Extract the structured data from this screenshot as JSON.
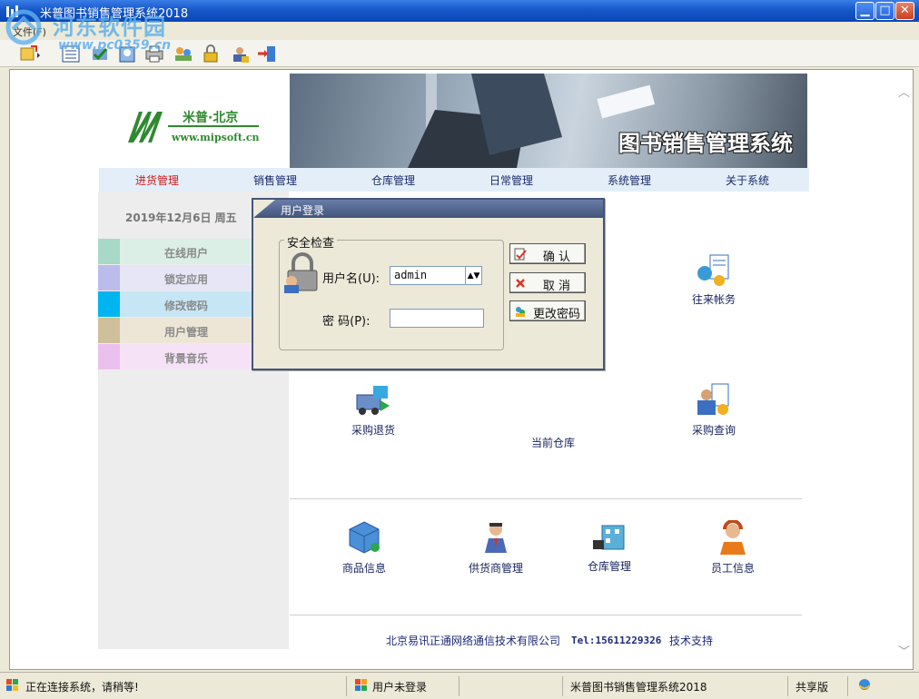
{
  "window": {
    "title": "米普图书销售管理系统2018",
    "minimize_label": "▁",
    "maximize_label": "□",
    "close_label": "✕"
  },
  "watermark": {
    "line1": "河东软件园",
    "line2": "www.pc0359.cn"
  },
  "menu": {
    "file_label": "文件(F)"
  },
  "toolbar": {
    "icons": [
      "new-icon",
      "list-icon",
      "check-icon",
      "user-icon",
      "print-icon",
      "people-icon",
      "lock-icon",
      "user-lock-icon",
      "exit-icon"
    ]
  },
  "logo": {
    "name": "米普·北京",
    "url": "www.mipsoft.cn"
  },
  "banner": {
    "title": "图书销售管理系统"
  },
  "nav": {
    "items": [
      "进货管理",
      "销售管理",
      "仓库管理",
      "日常管理",
      "系统管理",
      "关于系统"
    ]
  },
  "left_panel": {
    "date": "2019年12月6日  周五",
    "items": [
      {
        "label": "在线用户",
        "swatch": "#a8d8c8",
        "bg": "#dcefe6"
      },
      {
        "label": "锁定应用",
        "swatch": "#bcbcec",
        "bg": "#e6e6f6"
      },
      {
        "label": "修改密码",
        "swatch": "#00b4f0",
        "bg": "#c6e6f6"
      },
      {
        "label": "用户管理",
        "swatch": "#cfc09c",
        "bg": "#ede6d6"
      },
      {
        "label": "背景音乐",
        "swatch": "#ecc0ec",
        "bg": "#f6e2f6"
      }
    ]
  },
  "grid": {
    "row1": [
      {
        "label": "往来帐务",
        "icon": "accounts-icon"
      }
    ],
    "row2": [
      {
        "label": "采购退货",
        "icon": "purchase-return-icon"
      },
      {
        "label": "当前仓库",
        "icon": "current-warehouse-icon"
      },
      {
        "label": "采购查询",
        "icon": "purchase-query-icon"
      }
    ],
    "row3": [
      {
        "label": "商品信息",
        "icon": "goods-info-icon"
      },
      {
        "label": "供货商管理",
        "icon": "supplier-icon"
      },
      {
        "label": "仓库管理",
        "icon": "warehouse-icon"
      },
      {
        "label": "员工信息",
        "icon": "staff-icon"
      }
    ]
  },
  "footer": {
    "company": "北京易讯正通网络通信技术有限公司",
    "tel": "Tel:15611229326",
    "support": "技术支持"
  },
  "login_dialog": {
    "title": "用户登录",
    "group_label": "安全检查",
    "username_label": "用户名(U):",
    "username_value": "admin",
    "password_label": "密   码(P):",
    "password_value": "",
    "confirm_label": "确 认",
    "cancel_label": "取 消",
    "change_password_label": "更改密码"
  },
  "statusbar": {
    "connecting": "正在连接系统，请稍等!",
    "user_status": "用户未登录",
    "app_name": "米普图书销售管理系统2018",
    "edition": "共享版"
  },
  "colors": {
    "nav_active": "#d01a1a",
    "nav_text": "#1b2a6b",
    "dialog_title": "#43557a",
    "logo_green": "#2f8a2f"
  }
}
